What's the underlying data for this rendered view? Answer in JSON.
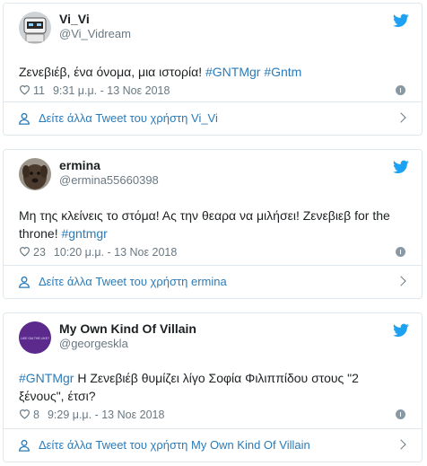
{
  "tweets": [
    {
      "name": "Vi_Vi",
      "handle": "@Vi_Vidream",
      "text_plain": "Ζενεβιέβ, ένα όνομα, μια ιστορία! ",
      "tag1": "#GNTMgr",
      "tag2": "#Gntm",
      "likes": "11",
      "time": "9:31 μ.μ. - 13 Νοε 2018",
      "footer": "Δείτε άλλα Tweet του χρήστη Vi_Vi",
      "avatar": "robot-avatar"
    },
    {
      "name": "ermina",
      "handle": "@ermina55660398",
      "text_plain": "Μη της κλείνεις το στόμα! Ας την θεαρα να μιλήσει! Ζενεβιεβ for the throne! ",
      "tag1": "#gntmgr",
      "likes": "23",
      "time": "10:20 μ.μ. - 13 Νοε 2018",
      "footer": "Δείτε άλλα Tweet του χρήστη ermina",
      "avatar": "dog-avatar"
    },
    {
      "name": "My Own Kind Of Villain",
      "handle": "@georgeskla",
      "tag1": "#GNTMgr",
      "text_plain": " Η Ζενεβιέβ θυμίζει λίγο Σοφία Φιλιππίδου στους \"2 ξένους\", έτσι?",
      "likes": "8",
      "time": "9:29 μ.μ. - 13 Νοε 2018",
      "footer": "Δείτε άλλα Tweet του χρήστη My Own Kind Of Villain",
      "avatar": "purple-avatar",
      "avatar_caption": "LIKE GIA THE LIKE?"
    }
  ],
  "colors": {
    "link": "#2b7bb9",
    "muted": "#697882",
    "twitter": "#1da1f2"
  }
}
